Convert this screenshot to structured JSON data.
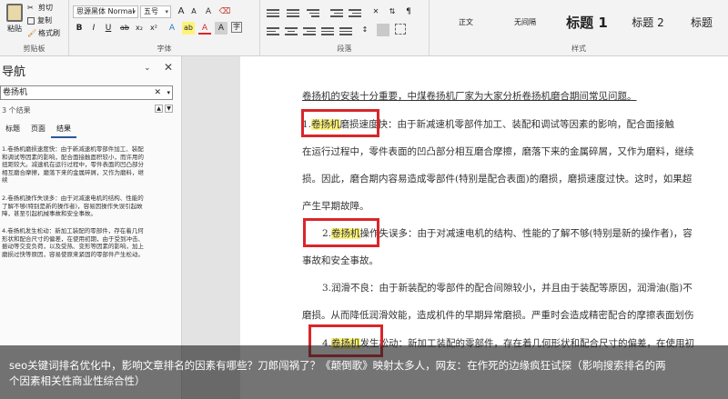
{
  "ribbon": {
    "clipboard": {
      "paste": "粘贴",
      "cut": "剪切",
      "copy": "复制",
      "format_painter": "格式刷",
      "label": "剪贴板"
    },
    "font": {
      "face": "思源黑体 Normal",
      "size": "五号",
      "grow": "A",
      "shrink": "A",
      "clear": "A",
      "bold": "B",
      "italic": "I",
      "underline": "U",
      "strike": "ab",
      "sub": "x₂",
      "sup": "x²",
      "effects": "A",
      "highlight": "ab",
      "color": "A",
      "char_shade": "A",
      "label": "字体"
    },
    "paragraph": {
      "label": "段落"
    },
    "styles": {
      "items": [
        "正文",
        "无间隔",
        "标题 1",
        "标题 2",
        "标题"
      ],
      "label": "样式"
    }
  },
  "nav": {
    "title": "导航",
    "search_value": "卷扬机",
    "results": "3 个结果",
    "tabs": [
      "标题",
      "页面",
      "结果"
    ],
    "items": [
      {
        "lines": [
          "1.卷扬机磨损速度快：由于新减速机零部件加工、装配",
          "和调试等因素的影响，配合面接触面积较小，而许用的",
          "扭距较大。减速机在运行过程中，零件表面的凹凸部分",
          "相互磨合摩擦，磨落下来的金属碎屑，又作为磨料，继",
          "续"
        ]
      },
      {
        "lines": [
          "2.卷扬机操作失误多：由于对减速电机的结构、性能的",
          "了解不够(特别是新的操作者)，容易因操作失误引起故",
          "障，甚至引起机械事故和安全事故。"
        ]
      },
      {
        "lines": [
          "4.卷扬机发生松动：新加工装配的零部件，存在着几何",
          "形状和配合尺寸的偏差，在使用初期，由于受到冲击、",
          "振动等交变负荷，以及受热、变形等因素的影响，加上",
          "磨损过快等原因，容易使原来紧固的零部件产生松动。"
        ]
      }
    ]
  },
  "document": {
    "lines": [
      {
        "pre": "",
        "hl": "",
        "text": "卷扬机的安装十分重要，中煤卷扬机厂家为大家分析卷扬机磨合期间常见问题。"
      },
      {
        "pre": "1.",
        "hl": "卷扬机",
        "text": "磨损速度快：由于新减速机零部件加工、装配和调试等因素的影响，配合面接触"
      },
      {
        "pre": "",
        "hl": "",
        "text": "在运行过程中，零件表面的凹凸部分相互磨合摩擦，磨落下来的金属碎屑，又作为磨料，继续"
      },
      {
        "pre": "",
        "hl": "",
        "text": "损。因此，磨合期内容易造成零部件(特别是配合表面)的磨损，磨损速度过快。这时，如果超"
      },
      {
        "pre": "",
        "hl": "",
        "text": "产生早期故障。"
      },
      {
        "pre": "2.",
        "hl": "卷扬机",
        "text": "操作失误多：由于对减速电机的结构、性能的了解不够(特别是新的操作者)，容"
      },
      {
        "pre": "",
        "hl": "",
        "text": "事故和安全事故。"
      },
      {
        "pre": "",
        "hl": "",
        "text": "3.润滑不良：由于新装配的零部件的配合间隙较小，并且由于装配等原因，润滑油(脂)不"
      },
      {
        "pre": "",
        "hl": "",
        "text": "磨损。从而降低润滑效能，造成机件的早期异常磨损。严重时会造成精密配合的摩擦表面划伤"
      },
      {
        "pre": "4.",
        "hl": "卷扬机",
        "text": "发生松动：新加工装配的零部件，存在着几何形状和配合尺寸的偏差，在使用初"
      }
    ]
  },
  "caption": {
    "line1": "seo关键词排名优化中，影响文章排名的因素有哪些？刀郎闯祸了？《颠倒歌》映射太多人，网友：在作死的边缘疯狂试探（影响搜索排名的两",
    "line2": "个因素相关性商业性综合性）"
  },
  "colors": {
    "highlight": "#fdf37a",
    "annotation_box": "#d9262a",
    "accent": "#2b579a"
  }
}
